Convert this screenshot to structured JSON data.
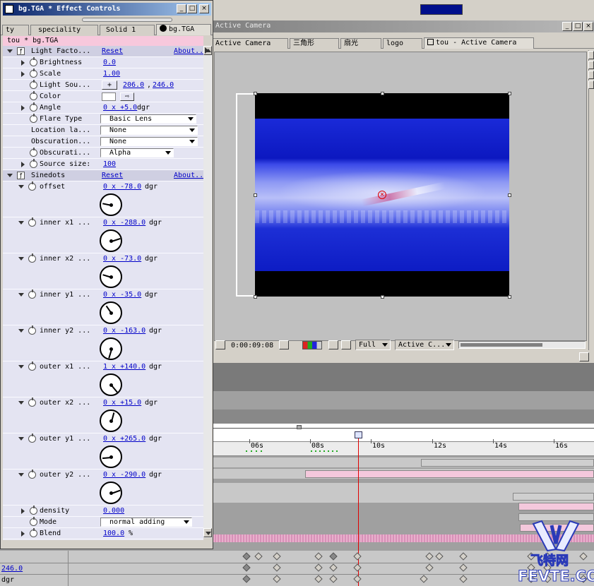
{
  "effect_window": {
    "title": "bg.TGA * Effect Controls",
    "tabs": [
      "ty",
      "speciality",
      "Solid 1",
      "bg.TGA"
    ],
    "breadcrumb": "tou * bg.TGA",
    "light_factory": {
      "name": "Light Facto...",
      "reset": "Reset",
      "about": "About...",
      "props": [
        {
          "label": "Brightness",
          "value": "0.0"
        },
        {
          "label": "Scale",
          "value": "1.00"
        },
        {
          "label": "Light Sou...",
          "x": "206.0",
          "sep": ",",
          "y": "246.0"
        },
        {
          "label": "Color"
        },
        {
          "label": "Angle",
          "value": "0 x +5.0",
          "unit": "dgr"
        },
        {
          "label": "Flare Type",
          "value": "Basic Lens"
        },
        {
          "label": "Location la...",
          "value": "None"
        },
        {
          "label": "Obscuration...",
          "value": "None"
        },
        {
          "label": "Obscurati...",
          "value": "Alpha"
        },
        {
          "label": "Source size:",
          "value": "100"
        }
      ]
    },
    "sinedots": {
      "name": "Sinedots",
      "reset": "Reset",
      "about": "About...",
      "angles": [
        {
          "label": "offset",
          "value": "0 x -78.0",
          "unit": "dgr",
          "deg": -78
        },
        {
          "label": "inner x1 ...",
          "value": "0 x -288.0",
          "unit": "dgr",
          "deg": -288
        },
        {
          "label": "inner x2 ...",
          "value": "0 x -73.0",
          "unit": "dgr",
          "deg": -73
        },
        {
          "label": "inner y1 ...",
          "value": "0 x -35.0",
          "unit": "dgr",
          "deg": -35
        },
        {
          "label": "inner y2 ...",
          "value": "0 x -163.0",
          "unit": "dgr",
          "deg": -163
        },
        {
          "label": "outer x1 ...",
          "value": "1 x +140.0",
          "unit": "dgr",
          "deg": 140
        },
        {
          "label": "outer x2 ...",
          "value": "0 x +15.0",
          "unit": "dgr",
          "deg": 15
        },
        {
          "label": "outer y1 ...",
          "value": "0 x +265.0",
          "unit": "dgr",
          "deg": 265
        },
        {
          "label": "outer y2 ...",
          "value": "0 x -290.0",
          "unit": "dgr",
          "deg": -290
        }
      ],
      "density": {
        "label": "density",
        "value": "0.000"
      },
      "mode": {
        "label": "Mode",
        "value": "normal adding"
      },
      "blend": {
        "label": "Blend",
        "value": "100.0",
        "unit": "%"
      }
    }
  },
  "comp_window": {
    "title": "Active Camera",
    "tabs": [
      "Active Camera",
      "三角形",
      "扇光",
      "logo",
      "tou - Active Camera"
    ],
    "timecode": "0:00:09:08",
    "resolution": "Full",
    "view": "Active C..."
  },
  "timeline": {
    "ticks": [
      "06s",
      "08s",
      "10s",
      "12s",
      "14s",
      "16s"
    ],
    "left_values": [
      "246.0",
      "dgr"
    ]
  },
  "watermark": {
    "line1": "飞特网",
    "line2": "FEVTE.COM"
  },
  "colors": {
    "accent_blue": "#0000c8",
    "title_bar": "#0a246a",
    "pink_bar": "#f4c8dc",
    "playhead": "#e00000"
  }
}
